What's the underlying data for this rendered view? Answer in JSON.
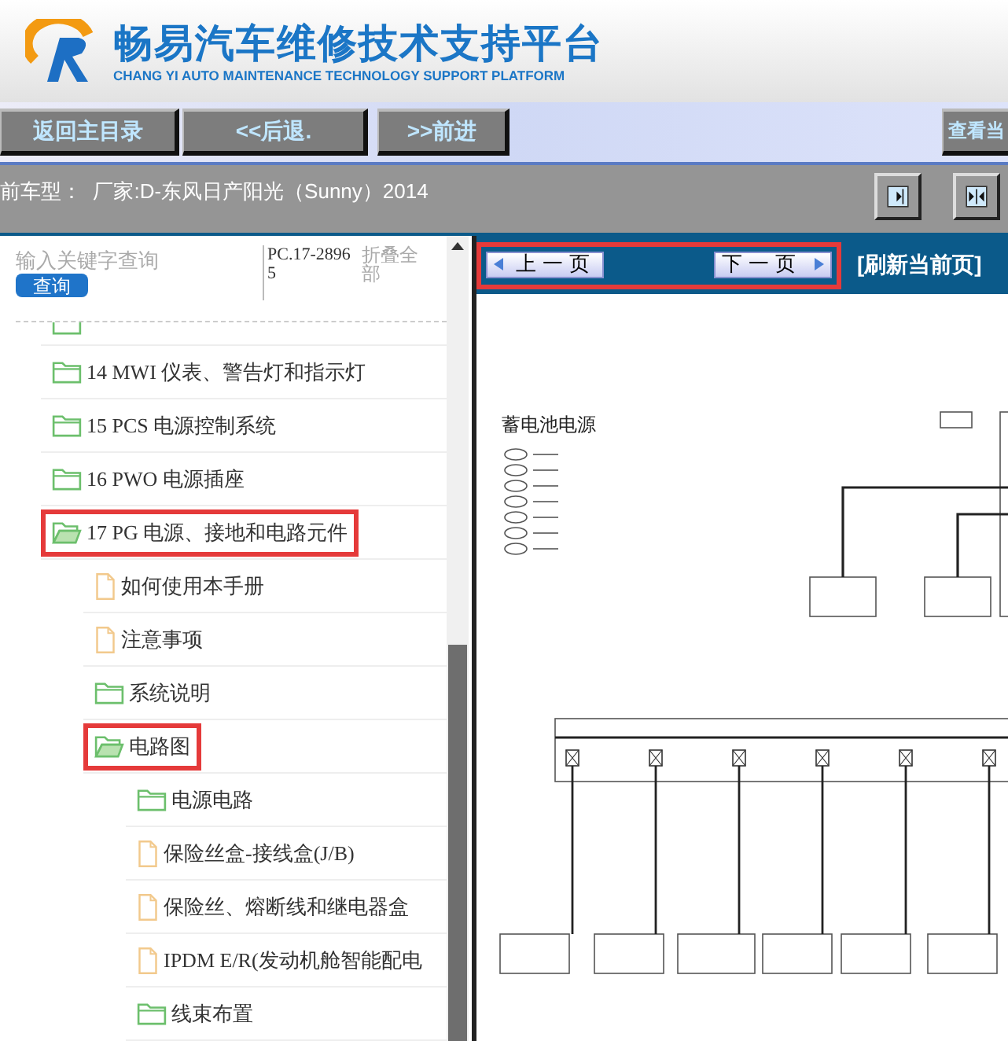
{
  "header": {
    "title": "畅易汽车维修技术支持平台",
    "subtitle": "CHANG YI AUTO MAINTENANCE TECHNOLOGY SUPPORT PLATFORM"
  },
  "nav_buttons": [
    {
      "label": "返回主目录"
    },
    {
      "label": "<<后退."
    },
    {
      "label": ">>前进"
    }
  ],
  "view_button": {
    "label": "查看当"
  },
  "model_bar": {
    "text": "前车型：  厂家:D-东风日产阳光（Sunny）2014"
  },
  "search": {
    "placeholder": "输入关键字查询",
    "button": "查询",
    "code": "PC.17-28965",
    "collapse": "折叠全部"
  },
  "tree": [
    {
      "kind": "folder",
      "expanded": false,
      "highlighted": false
    },
    {
      "kind": "folder",
      "label": "14 MWI 仪表、警告灯和指示灯",
      "expanded": false,
      "highlighted": false
    },
    {
      "kind": "folder",
      "label": "15 PCS 电源控制系统",
      "expanded": false,
      "highlighted": false
    },
    {
      "kind": "folder",
      "label": "16 PWO 电源插座",
      "expanded": false,
      "highlighted": false
    },
    {
      "kind": "folder",
      "label": "17 PG 电源、接地和电路元件",
      "expanded": true,
      "highlighted": true,
      "children": [
        {
          "kind": "doc",
          "label": "如何使用本手册",
          "highlighted": false
        },
        {
          "kind": "doc",
          "label": "注意事项",
          "highlighted": false
        },
        {
          "kind": "folder",
          "label": "系统说明",
          "expanded": false,
          "highlighted": false
        },
        {
          "kind": "folder",
          "label": "电路图",
          "expanded": true,
          "highlighted": true,
          "children": [
            {
              "kind": "folder",
              "label": "电源电路",
              "expanded": false,
              "highlighted": false
            },
            {
              "kind": "doc",
              "label": "保险丝盒-接线盒(J/B)",
              "highlighted": false
            },
            {
              "kind": "doc",
              "label": "保险丝、熔断线和继电器盒",
              "highlighted": false
            },
            {
              "kind": "doc",
              "label": "IPDM E/R(发动机舱智能配电",
              "highlighted": false
            },
            {
              "kind": "folder",
              "label": "线束布置",
              "expanded": false,
              "highlighted": false
            }
          ]
        }
      ]
    }
  ],
  "pager": {
    "prev": "上一页",
    "next": "下一页",
    "refresh": "[刷新当前页]",
    "highlighted": true
  },
  "document": {
    "title": "蓄电池电源"
  }
}
